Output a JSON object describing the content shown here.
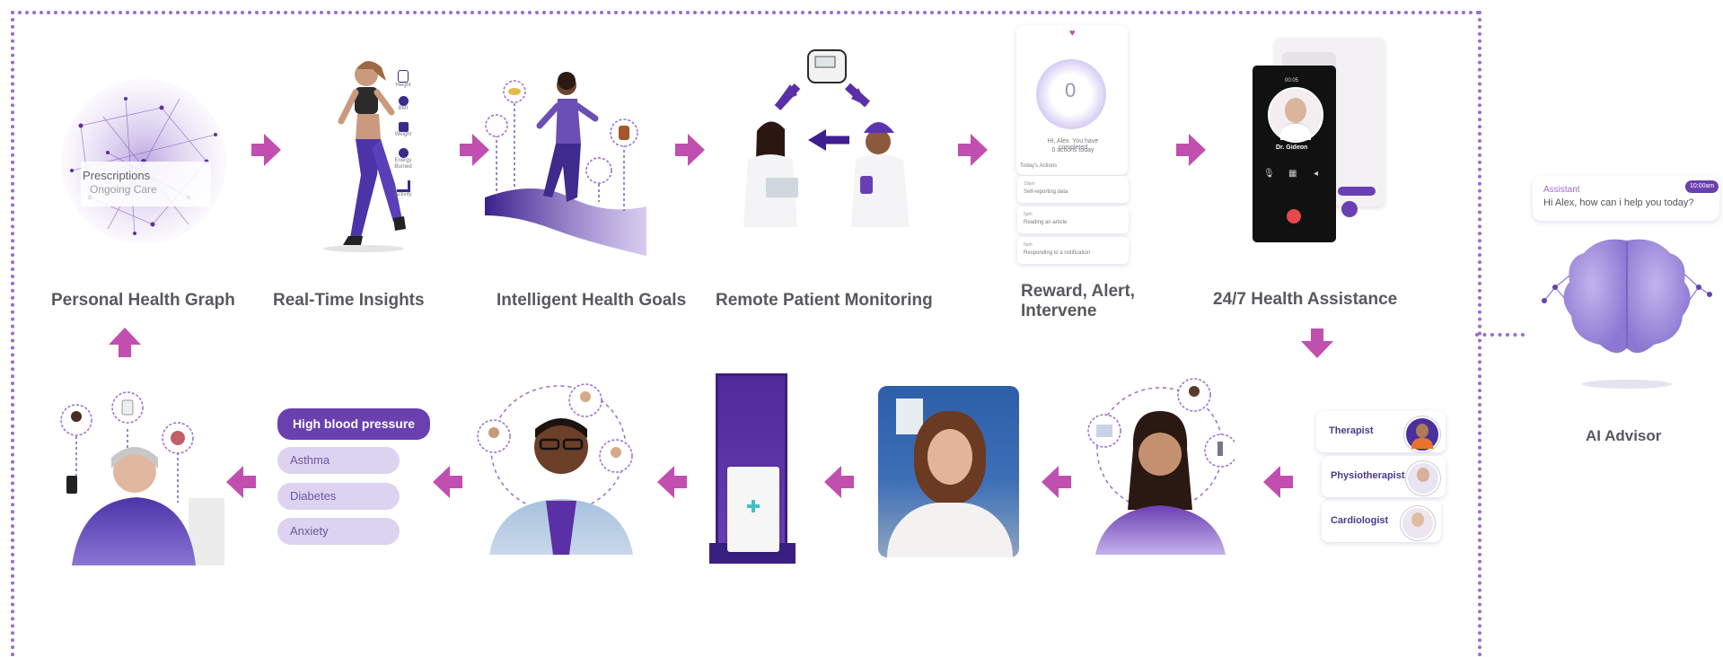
{
  "flow_top": [
    {
      "id": "graph",
      "label": "Personal Health Graph"
    },
    {
      "id": "insights",
      "label": "Real-Time Insights"
    },
    {
      "id": "goals",
      "label": "Intelligent Health Goals"
    },
    {
      "id": "monitoring",
      "label": "Remote Patient Monitoring"
    },
    {
      "id": "reward",
      "label": "Reward, Alert,\nIntervene"
    },
    {
      "id": "assist",
      "label": "24/7 Health Assistance"
    }
  ],
  "graph_node": {
    "title": "Prescriptions",
    "subtitle": "Ongoing Care"
  },
  "metrics": [
    "Height",
    "BMI",
    "Weight",
    "Energy Burned",
    "Activity"
  ],
  "app_card": {
    "score": "0",
    "greeting": "Hi, Alex. You have completed",
    "greeting2": "0 actions today",
    "section": "Today's Actions",
    "actions": [
      {
        "time": "10pm",
        "text": "Self-reporting data"
      },
      {
        "time": "5pm",
        "text": "Reading an article"
      },
      {
        "time": "5pm",
        "text": "Responding to a notification"
      }
    ]
  },
  "call": {
    "time": "00:05",
    "name": "Dr. Gideon"
  },
  "specialists": [
    "Therapist",
    "Physiotherapist",
    "Cardiologist"
  ],
  "conditions": [
    "High blood pressure",
    "Asthma",
    "Diabetes",
    "Anxiety"
  ],
  "advisor": {
    "label": "AI Advisor",
    "chat_role": "Assistant",
    "chat_time": "10:00am",
    "chat_text": "Hi Alex, how can i help you today?"
  },
  "colors": {
    "accent": "#c14fb0",
    "purple": "#6a3fb3",
    "frame": "#9b6bd0",
    "pill_active": "#6a40b0",
    "pill": "#dcd3f0"
  }
}
